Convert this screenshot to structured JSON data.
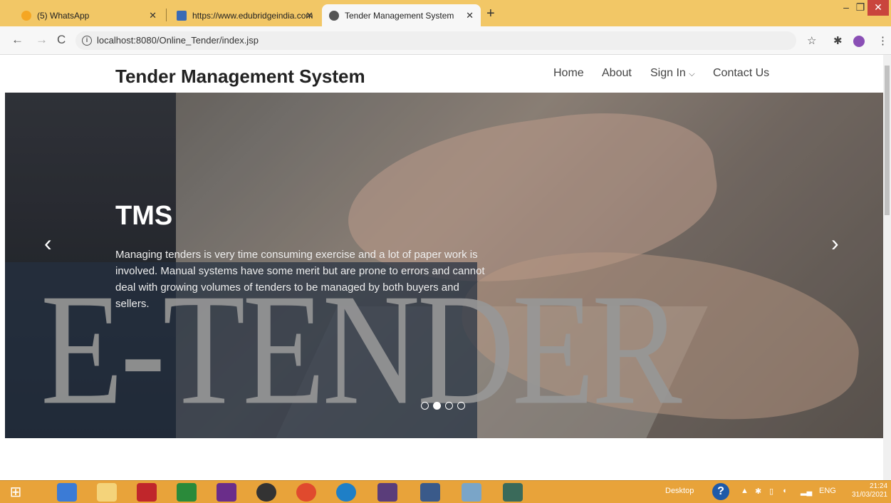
{
  "browser": {
    "tabs": [
      {
        "label": "(5) WhatsApp",
        "icon": "whatsapp-icon"
      },
      {
        "label": "https://www.edubridgeindia.com",
        "icon": "edubridge-icon"
      },
      {
        "label": "Tender Management System",
        "icon": "globe-icon",
        "active": true
      }
    ],
    "url": "localhost:8080/Online_Tender/index.jsp"
  },
  "site": {
    "brand": "Tender Management System",
    "nav": {
      "home": "Home",
      "about": "About",
      "signin": "Sign In",
      "contact": "Contact Us"
    },
    "hero": {
      "title": "TMS",
      "description": "Managing tenders is very time consuming exercise and a lot of paper work is involved. Manual systems have some merit but are prone to errors and cannot deal with growing volumes of tenders to be managed by both buyers and sellers.",
      "image_text": "E-TENDER",
      "slide_count": 4,
      "active_slide": 2
    }
  },
  "taskbar": {
    "desktop_label": "Desktop",
    "lang": "ENG",
    "time": "21:24",
    "date": "31/03/2021"
  },
  "colors": {
    "tabbar": "#f2c766",
    "taskbar": "#e8a33a"
  }
}
